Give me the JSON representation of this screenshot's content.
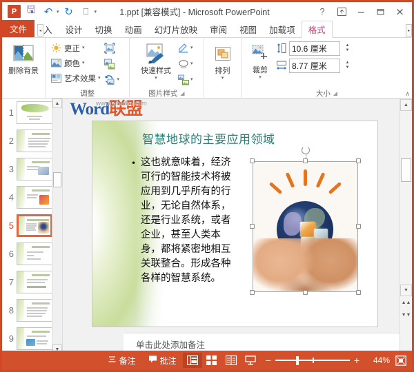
{
  "window": {
    "title": "1.ppt [兼容模式] - Microsoft PowerPoint",
    "quick_access": [
      {
        "name": "powerpoint-logo",
        "label": "P"
      },
      {
        "name": "save-icon",
        "label": "⬜"
      },
      {
        "name": "undo-icon",
        "label": "↶"
      },
      {
        "name": "redo-icon",
        "label": "↻"
      },
      {
        "name": "start-slideshow-icon",
        "label": "▷"
      },
      {
        "name": "customize-qat-icon",
        "label": "▾"
      }
    ],
    "controls": {
      "help": "?",
      "ribbon_display": "⬆",
      "minimize": "—",
      "restore": "❐",
      "close": "✕"
    }
  },
  "ribbon": {
    "file_tab": "文件",
    "scroll_left": "◂",
    "scroll_right": "▸",
    "tabs": [
      {
        "label": "入",
        "active": false,
        "clipped": true
      },
      {
        "label": "设计",
        "active": false
      },
      {
        "label": "切换",
        "active": false
      },
      {
        "label": "动画",
        "active": false
      },
      {
        "label": "幻灯片放映",
        "active": false
      },
      {
        "label": "审阅",
        "active": false
      },
      {
        "label": "视图",
        "active": false
      },
      {
        "label": "加载项",
        "active": false
      },
      {
        "label": "格式",
        "active": true
      }
    ],
    "active_tab_color": "#c0407a",
    "groups": [
      {
        "id": "remove_background",
        "label": "",
        "buttons": [
          {
            "name": "remove-background-button",
            "label": "删除背景"
          }
        ]
      },
      {
        "id": "adjust",
        "label": "调整",
        "buttons": [
          {
            "name": "corrections-button",
            "label": "更正"
          },
          {
            "name": "color-button",
            "label": "颜色"
          },
          {
            "name": "artistic-effects-button",
            "label": "艺术效果"
          },
          {
            "name": "compress-pictures-button",
            "label": ""
          },
          {
            "name": "change-picture-button",
            "label": ""
          },
          {
            "name": "reset-picture-button",
            "label": ""
          }
        ]
      },
      {
        "id": "picture_styles",
        "label": "图片样式",
        "buttons": [
          {
            "name": "quick-styles-button",
            "label": "快速样式"
          },
          {
            "name": "picture-border-button",
            "label": ""
          },
          {
            "name": "picture-effects-button",
            "label": ""
          },
          {
            "name": "picture-layout-button",
            "label": ""
          }
        ]
      },
      {
        "id": "arrange",
        "label": "",
        "buttons": [
          {
            "name": "arrange-button",
            "label": "排列"
          }
        ]
      },
      {
        "id": "size",
        "label": "大小",
        "buttons": [
          {
            "name": "crop-button",
            "label": "裁剪"
          }
        ],
        "fields": [
          {
            "name": "shape-height-input",
            "value": "10.6 厘米"
          },
          {
            "name": "shape-width-input",
            "value": "8.77 厘米"
          }
        ]
      }
    ],
    "collapse_ribbon": "∧"
  },
  "slide_panel": {
    "slides": [
      {
        "number": "1",
        "selected": false
      },
      {
        "number": "2",
        "selected": false
      },
      {
        "number": "3",
        "selected": false
      },
      {
        "number": "4",
        "selected": false
      },
      {
        "number": "5",
        "selected": true
      },
      {
        "number": "6",
        "selected": false
      },
      {
        "number": "7",
        "selected": false
      },
      {
        "number": "8",
        "selected": false
      },
      {
        "number": "9",
        "selected": false
      }
    ],
    "selection_color": "#e8633a",
    "scroll_up": "▲",
    "scroll_down": "▼"
  },
  "slide": {
    "title": "智慧地球的主要应用领域",
    "title_color": "#2a7d78",
    "bullet_symbol": "•",
    "body": "这也就意味着，经济可行的智能技术将被应用到几乎所有的行业，无论自然体系，还是行业系统，或者企业，甚至人类本身，都将紧密地相互关联整合。形成各种各样的智慧系统。",
    "picture_alt": "hands-holding-earth-picture",
    "selected": true
  },
  "watermark": {
    "url": "www.wordlm.com",
    "brand_en": "Word",
    "brand_cn": "联盟"
  },
  "notes": {
    "placeholder": "单击此处添加备注"
  },
  "statusbar": {
    "notes_label": "备注",
    "comments_label": "批注",
    "views": [
      {
        "name": "normal-view-button",
        "active": true
      },
      {
        "name": "slide-sorter-view-button",
        "active": false
      },
      {
        "name": "reading-view-button",
        "active": false
      },
      {
        "name": "slide-show-button",
        "active": false
      }
    ],
    "zoom_out": "−",
    "zoom_in": "+",
    "zoom_level": "44%",
    "fit_label": "fit-to-window",
    "background": "#d2502c"
  }
}
